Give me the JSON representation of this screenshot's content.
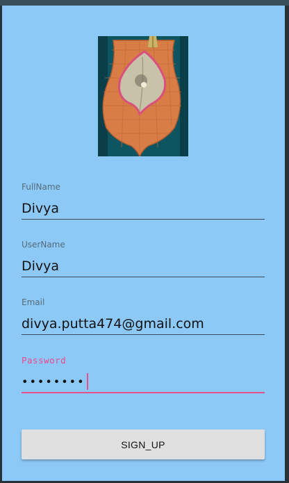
{
  "form": {
    "fields": [
      {
        "label": "FullName",
        "value": "Divya"
      },
      {
        "label": "UserName",
        "value": "Divya"
      },
      {
        "label": "Email",
        "value": "divya.putta474@gmail.com"
      },
      {
        "label": "Password",
        "value": "••••••••"
      }
    ],
    "submit_label": "SIGN_UP"
  },
  "colors": {
    "background": "#8cc9f7",
    "focus_accent": "#ea4f8d",
    "button": "#e0e0e0"
  },
  "icons": {
    "header_image": "leaf-plaque-image"
  }
}
